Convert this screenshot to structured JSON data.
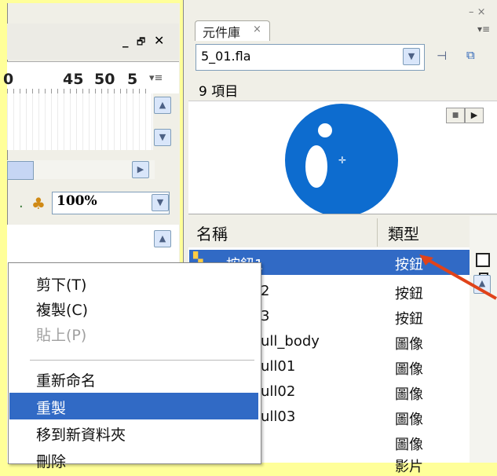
{
  "timeline": {
    "ruler_numbers": [
      "0",
      "45",
      "50",
      "5"
    ],
    "zoom": "100%"
  },
  "library": {
    "tab_label": "元件庫",
    "tab_close": "×",
    "file_name": "5_01.fla",
    "item_count": "9 項目",
    "columns": {
      "name": "名稱",
      "type": "類型"
    },
    "rows": [
      {
        "name": "按鈕1",
        "type": "按鈕"
      },
      {
        "name": "2",
        "type": "按鈕"
      },
      {
        "name": "3",
        "type": "按鈕"
      },
      {
        "name": "ull_body",
        "type": "圖像"
      },
      {
        "name": "ull01",
        "type": "圖像"
      },
      {
        "name": "ull02",
        "type": "圖像"
      },
      {
        "name": "ull03",
        "type": "圖像"
      },
      {
        "name": "",
        "type": "圖像"
      },
      {
        "name": "",
        "type": "影片"
      }
    ]
  },
  "context_menu": {
    "items": [
      {
        "label": "剪下(T)",
        "enabled": true
      },
      {
        "label": "複製(C)",
        "enabled": true
      },
      {
        "label": "貼上(P)",
        "enabled": false
      },
      {
        "label": "重新命名",
        "enabled": true
      },
      {
        "label": "重製",
        "enabled": true,
        "highlighted": true
      },
      {
        "label": "移到新資料夾",
        "enabled": true
      },
      {
        "label": "刪除",
        "enabled": true
      }
    ]
  },
  "colors": {
    "background": "#ffff99",
    "selection": "#316ac5",
    "preview_circle": "#0d6ccf",
    "arrow": "#e0431a"
  }
}
